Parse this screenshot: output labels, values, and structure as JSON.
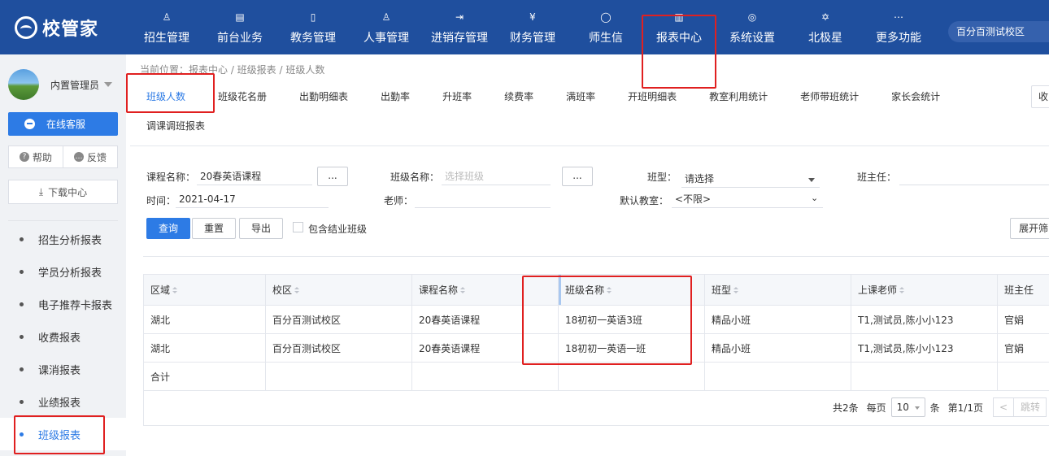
{
  "brand": {
    "name": "校管家"
  },
  "nav": {
    "items": [
      {
        "label": "招生管理",
        "icon": "user-plus-icon"
      },
      {
        "label": "前台业务",
        "icon": "desk-icon"
      },
      {
        "label": "教务管理",
        "icon": "book-icon"
      },
      {
        "label": "人事管理",
        "icon": "person-icon"
      },
      {
        "label": "进销存管理",
        "icon": "inventory-icon"
      },
      {
        "label": "财务管理",
        "icon": "yuan-icon"
      },
      {
        "label": "师生信",
        "icon": "chat-icon"
      },
      {
        "label": "报表中心",
        "icon": "report-icon"
      },
      {
        "label": "系统设置",
        "icon": "settings-icon"
      },
      {
        "label": "北极星",
        "icon": "star-icon"
      },
      {
        "label": "更多功能",
        "icon": "more-icon"
      }
    ],
    "campus": "百分百测试校区"
  },
  "sidebar": {
    "username": "内置管理员",
    "service": "在线客服",
    "help": "帮助",
    "feedback": "反馈",
    "download": "下载中心",
    "menu": [
      "招生分析报表",
      "学员分析报表",
      "电子推荐卡报表",
      "收费报表",
      "课消报表",
      "业绩报表",
      "班级报表"
    ]
  },
  "breadcrumb": "当前位置：报表中心 / 班级报表 / 班级人数",
  "tabs": {
    "row1": [
      "班级人数",
      "班级花名册",
      "出勤明细表",
      "出勤率",
      "升班率",
      "续费率",
      "满班率",
      "开班明细表",
      "教室利用统计",
      "老师带班统计",
      "家长会统计"
    ],
    "row2": [
      "调课调班报表"
    ],
    "collapse": "收"
  },
  "filters": {
    "course_label": "课程名称：",
    "course_value": "20春英语课程",
    "dots": "...",
    "class_label": "班级名称：",
    "class_placeholder": "选择班级",
    "type_label": "班型：",
    "type_value": "请选择",
    "head_teacher_label": "班主任：",
    "time_label": "时间：",
    "time_value": "2021-04-17",
    "teacher_label": "老师：",
    "room_label": "默认教室：",
    "room_value": "<不限>",
    "query": "查询",
    "reset": "重置",
    "export": "导出",
    "include_graduated": "包含结业班级",
    "expand": "展开筛"
  },
  "table": {
    "headers": [
      "区域",
      "校区",
      "课程名称",
      "班级名称",
      "班型",
      "上课老师",
      "班主任"
    ],
    "rows": [
      [
        "湖北",
        "百分百测试校区",
        "20春英语课程",
        "18初初一英语3班",
        "精品小班",
        "T1,测试员,陈小小123",
        "官娟"
      ],
      [
        "湖北",
        "百分百测试校区",
        "20春英语课程",
        "18初初一英语一班",
        "精品小班",
        "T1,测试员,陈小小123",
        "官娟"
      ]
    ],
    "total_label": "合计"
  },
  "pager": {
    "total": "共2条",
    "per_page_label": "每页",
    "per_page": "10",
    "unit": "条",
    "page_info": "第1/1页",
    "prev": "<",
    "jump": "跳转"
  },
  "colors": {
    "nav_bg": "#1f4f9e",
    "primary": "#2d7be5",
    "annotation": "#e02020"
  }
}
